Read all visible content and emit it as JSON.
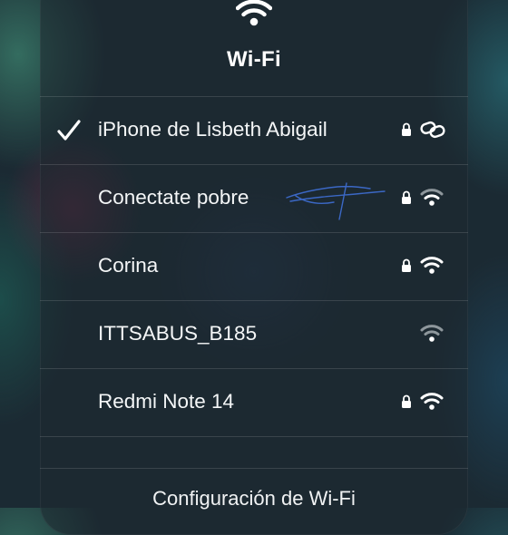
{
  "header": {
    "title": "Wi-Fi",
    "icon": "wifi-icon"
  },
  "networks": [
    {
      "name": "iPhone de Lisbeth Abigail",
      "connected": true,
      "secured": true,
      "type": "personal-hotspot",
      "icon": "link-icon"
    },
    {
      "name": "Conectate pobre",
      "connected": false,
      "secured": true,
      "type": "wifi",
      "signal_bars": 2,
      "icon": "wifi-signal-icon"
    },
    {
      "name": "Corina",
      "connected": false,
      "secured": true,
      "type": "wifi",
      "signal_bars": 3,
      "icon": "wifi-signal-icon"
    },
    {
      "name": "ITTSABUS_B185",
      "connected": false,
      "secured": false,
      "type": "wifi",
      "signal_bars": 1,
      "icon": "wifi-signal-icon"
    },
    {
      "name": "Redmi Note 14",
      "connected": false,
      "secured": true,
      "type": "wifi",
      "signal_bars": 3,
      "icon": "wifi-signal-icon"
    }
  ],
  "footer": {
    "settings_label": "Configuración de Wi-Fi"
  },
  "colors": {
    "text": "#ffffff",
    "dim_signal": "#8e979c",
    "scribble": "#3f6fd6"
  }
}
